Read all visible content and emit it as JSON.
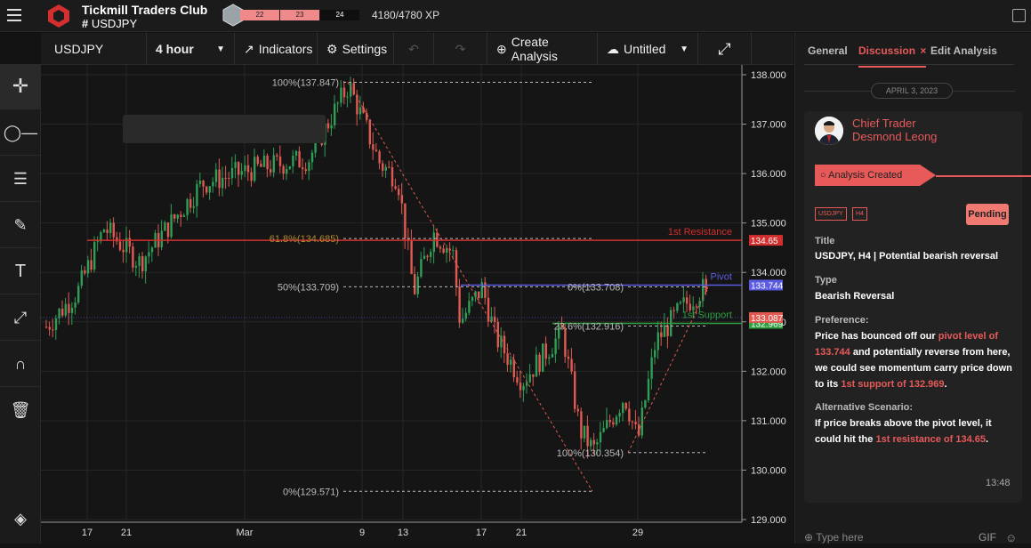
{
  "app": {
    "club": "Tickmill Traders Club",
    "symbol": "USDJPY",
    "levels": [
      "22",
      "23",
      "24"
    ],
    "xp": "4180/4780 XP"
  },
  "toolbar": {
    "symbol": "USDJPY",
    "interval": "4 hour",
    "indicators": "Indicators",
    "settings": "Settings",
    "create": "Create Analysis",
    "untitled": "Untitled"
  },
  "side": {
    "tabs": [
      "General",
      "Discussion",
      "Edit Analysis"
    ],
    "date": "APRIL 3, 2023",
    "role": "Chief Trader",
    "name": "Desmond Leong",
    "created": "Analysis Created",
    "tags": [
      "USDJPY",
      "H4"
    ],
    "status": "Pending",
    "title_label": "Title",
    "title": "USDJPY, H4 | Potential bearish reversal",
    "type_label": "Type",
    "type": "Bearish Reversal",
    "pref_label": "Preference:",
    "pref_1": "Price has bounced off our ",
    "pref_hl1": "pivot level of 133.744",
    "pref_2": " and potentially reverse from here, we could see momentum carry price down to its ",
    "pref_hl2": "1st support of 132.969",
    "pref_3": ".",
    "alt_label": "Alternative Scenario:",
    "alt_1": "If price breaks above the pivot level, it could hit the ",
    "alt_hl": "1st resistance of 134.65",
    "alt_2": ".",
    "time": "13:48",
    "input_placeholder": "Type here",
    "gif": "GIF"
  },
  "chart_data": {
    "type": "candlestick",
    "ylim": [
      129.0,
      138.0
    ],
    "yticks": [
      "138.000",
      "137.000",
      "136.000",
      "135.000",
      "134.000",
      "133.000",
      "132.000",
      "131.000",
      "130.000",
      "129.000"
    ],
    "xticks": [
      "17",
      "21",
      "Mar",
      "9",
      "13",
      "17",
      "21",
      "29"
    ],
    "levels": [
      {
        "label": "1st Resistance",
        "price": 134.65,
        "tag": "134.65",
        "color": "#d32f2f"
      },
      {
        "label": "Pivot",
        "price": 133.744,
        "tag": "133.744",
        "color": "#5c5ce0"
      },
      {
        "label": "1st Support",
        "price": 132.969,
        "tag": "132.969",
        "color": "#2e9e3e"
      }
    ],
    "current_price": "133.087",
    "fib1": [
      {
        "label": "100%(137.847)",
        "price": 137.847
      },
      {
        "label": "61.8%(134.685)",
        "price": 134.685
      },
      {
        "label": "50%(133.709)",
        "price": 133.709
      },
      {
        "label": "0%(129.571)",
        "price": 129.571
      }
    ],
    "fib2": [
      {
        "label": "0%(133.708)",
        "price": 133.708
      },
      {
        "label": "23.6%(132.916)",
        "price": 132.916
      },
      {
        "label": "100%(130.354)",
        "price": 130.354
      }
    ]
  }
}
